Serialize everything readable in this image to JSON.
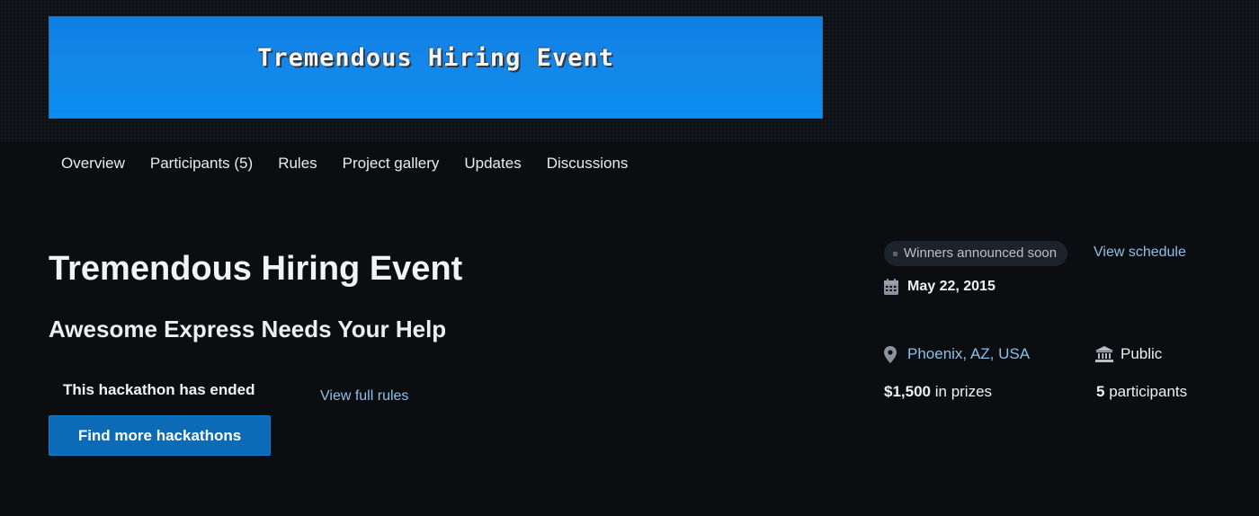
{
  "banner": {
    "title": "Tremendous Hiring Event"
  },
  "tabs": [
    {
      "label": "Overview"
    },
    {
      "label": "Participants (5)"
    },
    {
      "label": "Rules"
    },
    {
      "label": "Project gallery"
    },
    {
      "label": "Updates"
    },
    {
      "label": "Discussions"
    }
  ],
  "main": {
    "title": "Tremendous Hiring Event",
    "tagline": "Awesome Express Needs Your Help",
    "ended_text": "This hackathon has ended",
    "rules_link": "View full rules",
    "cta_label": "Find more hackathons"
  },
  "sidebar": {
    "status": "Winners announced soon",
    "schedule_link": "View schedule",
    "date": "May 22, 2015",
    "location": "Phoenix, AZ, USA",
    "visibility": "Public",
    "prize_amount": "$1,500",
    "prize_suffix": "in prizes",
    "participant_count": "5",
    "participant_suffix": "participants"
  },
  "icons": {
    "calendar": "calendar-icon",
    "location": "map-pin-icon",
    "visibility": "public-building-icon"
  },
  "colors": {
    "background": "#0b0d10",
    "banner": "#0d7fe6",
    "link": "#8ec0e8",
    "button": "#0c6bb6"
  }
}
